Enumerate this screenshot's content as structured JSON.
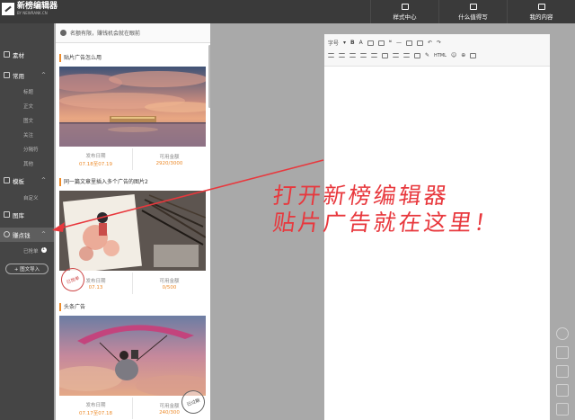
{
  "app": {
    "title": "新榜编辑器",
    "subtitle": "BY NEWRANK.CN"
  },
  "top_nav": [
    {
      "label": "样式中心",
      "icon": "style-icon"
    },
    {
      "label": "什么值得写",
      "icon": "idea-icon"
    },
    {
      "label": "我的内容",
      "icon": "document-icon"
    }
  ],
  "sidebar": {
    "sections": [
      {
        "label": "素材",
        "icon": "material-icon"
      },
      {
        "label": "常用",
        "icon": "layers-icon",
        "chevron": "^"
      },
      {
        "label": "模板",
        "icon": "template-icon",
        "chevron": "^"
      },
      {
        "label": "图库",
        "icon": "image-icon"
      },
      {
        "label": "赚点钱",
        "icon": "money-icon",
        "chevron": "^"
      }
    ],
    "common_items": [
      "标题",
      "正文",
      "图文",
      "关注",
      "分隔符",
      "其他"
    ],
    "template_items": [
      "自定义"
    ],
    "money_items": [
      {
        "label": "已抢单",
        "badge": "1"
      }
    ],
    "import_button": "+ 图文导入"
  },
  "panel": {
    "notice": "名额有限，赚钱机会就在眼前",
    "cards": [
      {
        "title": "贴片广告怎么用",
        "publish_label": "发布日期",
        "publish_value": "07.18至07.19",
        "amount_label": "可用金额",
        "amount_value": "2920/3000"
      },
      {
        "title": "同一篇文章里插入多个广告的图片2",
        "publish_label": "发布日期",
        "publish_value": "07.13",
        "amount_label": "可用金额",
        "amount_value": "0/500",
        "stamp": "已抢单"
      },
      {
        "title": "头条广告",
        "publish_label": "发布日期",
        "publish_value": "07.17至07.18",
        "amount_label": "可用金额",
        "amount_value": "240/300",
        "stamp": "已过期"
      }
    ]
  },
  "editor": {
    "font_label": "字号",
    "html_label": "HTML"
  },
  "annotation": {
    "line1": "打开新榜编辑器",
    "line2": "贴片广告就在这里！",
    "color": "#e8383d"
  },
  "colors": {
    "accent": "#ec8b2b",
    "topbar": "#3a3a3a",
    "sidebar": "#454545"
  }
}
